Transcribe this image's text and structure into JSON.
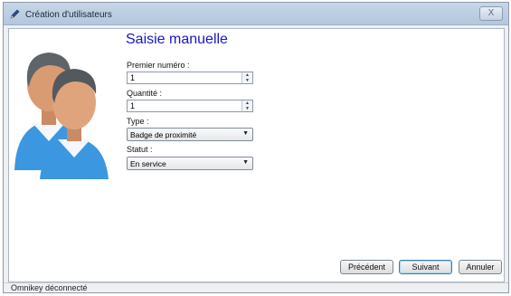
{
  "window": {
    "title": "Création d'utilisateurs",
    "close_glyph": "X"
  },
  "heading": "Saisie manuelle",
  "form": {
    "first_number": {
      "label": "Premier numéro :",
      "value": "1"
    },
    "quantity": {
      "label": "Quantité :",
      "value": "1"
    },
    "type": {
      "label": "Type :",
      "selected": "Badge de proximité"
    },
    "status": {
      "label": "Statut :",
      "selected": "En service"
    }
  },
  "buttons": {
    "previous": "Précédent",
    "next": "Suivant",
    "cancel": "Annuler"
  },
  "statusbar": {
    "text": "Omnikey déconnecté"
  },
  "icons": {
    "title": "pen-icon",
    "illustration": "users-icon",
    "spin_up": "arrow-up-icon",
    "spin_down": "arrow-down-icon",
    "dropdown": "chevron-down-icon"
  },
  "colors": {
    "heading": "#1717c6",
    "titlebar": "#b3c6de"
  }
}
